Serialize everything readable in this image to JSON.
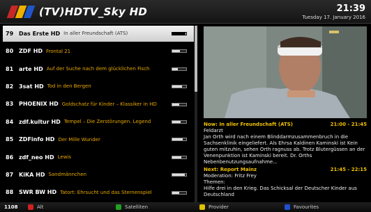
{
  "header": {
    "channel_title": "(TV)HDTV_Sky HD",
    "clock": "21:39",
    "date": "Tuesday 17. January 2016"
  },
  "channels": [
    {
      "num": "79",
      "name": "Das Erste HD",
      "program": "In aller Freundschaft (ATS)",
      "progress": 0.95,
      "selected": true
    },
    {
      "num": "80",
      "name": "ZDF HD",
      "program": "Frontal 21",
      "progress": 0.55,
      "selected": false
    },
    {
      "num": "81",
      "name": "arte HD",
      "program": "Auf der Suche nach dem glücklichen Fisch",
      "progress": 0.4,
      "selected": false
    },
    {
      "num": "82",
      "name": "3sat HD",
      "program": "Tod in den Bergen",
      "progress": 0.7,
      "selected": false
    },
    {
      "num": "83",
      "name": "PHOENIX HD",
      "program": "Goldschatz für Kinder – Klassiker in HD",
      "progress": 0.5,
      "selected": false
    },
    {
      "num": "84",
      "name": "zdf.kultur HD",
      "program": "Tempel – Die Zerstörungen. Legend",
      "progress": 0.6,
      "selected": false
    },
    {
      "num": "85",
      "name": "ZDFinfo HD",
      "program": "Der Mille Wunder",
      "progress": 0.75,
      "selected": false
    },
    {
      "num": "86",
      "name": "zdf_neo HD",
      "program": "Lewis",
      "progress": 0.65,
      "selected": false
    },
    {
      "num": "87",
      "name": "KiKA HD",
      "program": "Sandmännchen",
      "progress": 0.9,
      "selected": false
    },
    {
      "num": "88",
      "name": "SWR BW HD",
      "program": "Tatort: Ehrsucht und das Sternenspiel",
      "progress": 0.5,
      "selected": false
    }
  ],
  "info": {
    "now_title": "Now: In aller Freundschaft (ATS)",
    "now_time": "21:00 - 21:45",
    "now_genre": "Feldarzt",
    "now_desc": "Jan Orth wird nach einem Blinddarmzusammenbruch in die Sachsenklinik eingeliefert. Als Ehrsa Kaldinen Kaminski ist Kein guten mitzuhin, sehen Orth ragnuss ab. Trotz Blutergüssen an der Venenpunktion ist Kaminski bereit. Dr. Orths Nebenbenutzungsaufnahme...",
    "next_title": "Next: Report Mainz",
    "next_time": "21:45 - 22:15",
    "next_moderation": "Moderation: Fritz Frey",
    "next_themes": "Themen:",
    "next_desc": "Hilfe drei in den Krieg. Das Schicksal der Deutscher Kinder aus Deutschland"
  },
  "footer": {
    "count": "1108",
    "keys": [
      {
        "label": "Alt",
        "color": "#d02020"
      },
      {
        "label": "Satelliten",
        "color": "#20a020"
      },
      {
        "label": "Provider",
        "color": "#e0c000"
      },
      {
        "label": "Favourites",
        "color": "#2050d0"
      }
    ]
  }
}
